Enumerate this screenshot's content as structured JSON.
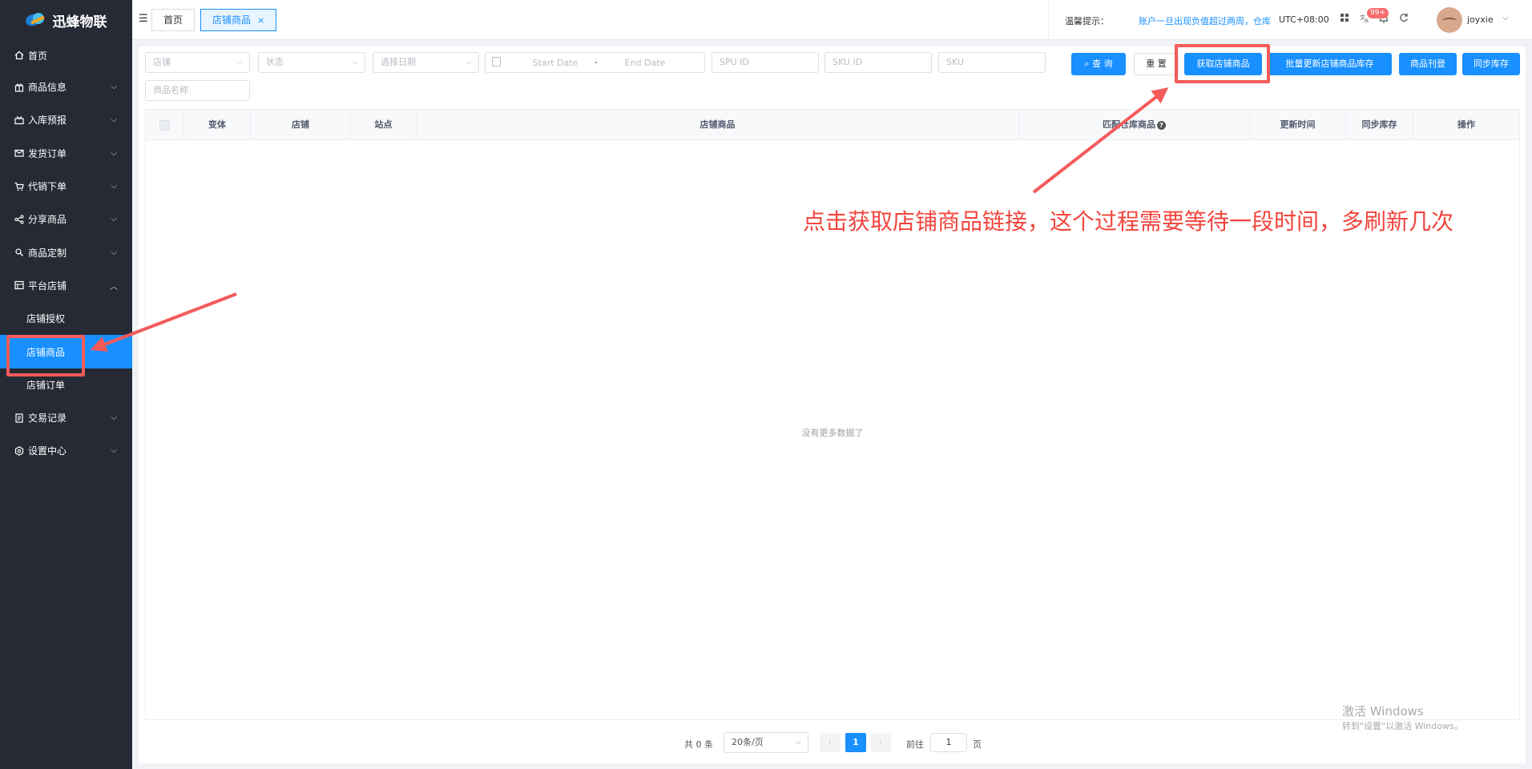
{
  "brand": {
    "name": "迅蜂物联"
  },
  "sidebar": {
    "items": [
      {
        "label": "首页",
        "icon": "home-icon",
        "has_children": false
      },
      {
        "label": "商品信息",
        "icon": "gift-icon",
        "has_children": true
      },
      {
        "label": "入库预报",
        "icon": "box-in-icon",
        "has_children": true
      },
      {
        "label": "发货订单",
        "icon": "mail-icon",
        "has_children": true
      },
      {
        "label": "代销下单",
        "icon": "cart-icon",
        "has_children": true
      },
      {
        "label": "分享商品",
        "icon": "share-icon",
        "has_children": true
      },
      {
        "label": "商品定制",
        "icon": "custom-icon",
        "has_children": true
      },
      {
        "label": "平台店铺",
        "icon": "store-icon",
        "has_children": true,
        "expanded": true,
        "children": [
          {
            "label": "店铺授权",
            "active": false
          },
          {
            "label": "店铺商品",
            "active": true
          },
          {
            "label": "店铺订单",
            "active": false
          }
        ]
      },
      {
        "label": "交易记录",
        "icon": "document-icon",
        "has_children": true
      },
      {
        "label": "设置中心",
        "icon": "settings-icon",
        "has_children": true
      }
    ]
  },
  "header": {
    "tabs": [
      {
        "label": "首页",
        "active": false
      },
      {
        "label": "店铺商品",
        "active": true,
        "close": "×"
      }
    ],
    "tip_label": "温馨提示：",
    "tip_text": "账户一旦出现负值超过两周，仓库",
    "timezone": "UTC+08:00",
    "badge": "99+",
    "username": "joyxie"
  },
  "filters": {
    "store_placeholder": "店铺",
    "status_placeholder": "状态",
    "date_type_placeholder": "选择日期",
    "start_date": "Start Date",
    "date_sep": "-",
    "end_date": "End Date",
    "spu_placeholder": "SPU ID",
    "sku_id_placeholder": "SKU ID",
    "sku_placeholder": "SKU",
    "name_placeholder": "商品名称"
  },
  "buttons": {
    "query": "查 询",
    "reset": "重 置",
    "fetch": "获取店铺商品",
    "batch_update": "批量更新店铺商品库存",
    "publish": "商品刊登",
    "sync": "同步库存"
  },
  "table": {
    "columns": [
      "变体",
      "店铺",
      "站点",
      "店铺商品",
      "匹配仓库商品",
      "更新时间",
      "同步库存",
      "操作"
    ],
    "help": "?",
    "empty_text": "没有更多数据了"
  },
  "pagination": {
    "total": "共 0 条",
    "page_size": "20条/页",
    "prev": "‹",
    "current": "1",
    "next": "›",
    "goto_label": "前往",
    "goto_value": "1",
    "page_suffix": "页"
  },
  "annotation": {
    "text": "点击获取店铺商品链接，这个过程需要等待一段时间，多刷新几次",
    "color": "#f2453d"
  },
  "watermark": {
    "line1": "激活 Windows",
    "line2": "转到\"设置\"以激活 Windows。"
  },
  "colors": {
    "primary": "#1890ff",
    "sidebar_bg": "#252a34",
    "highlight": "#f35b5b"
  }
}
